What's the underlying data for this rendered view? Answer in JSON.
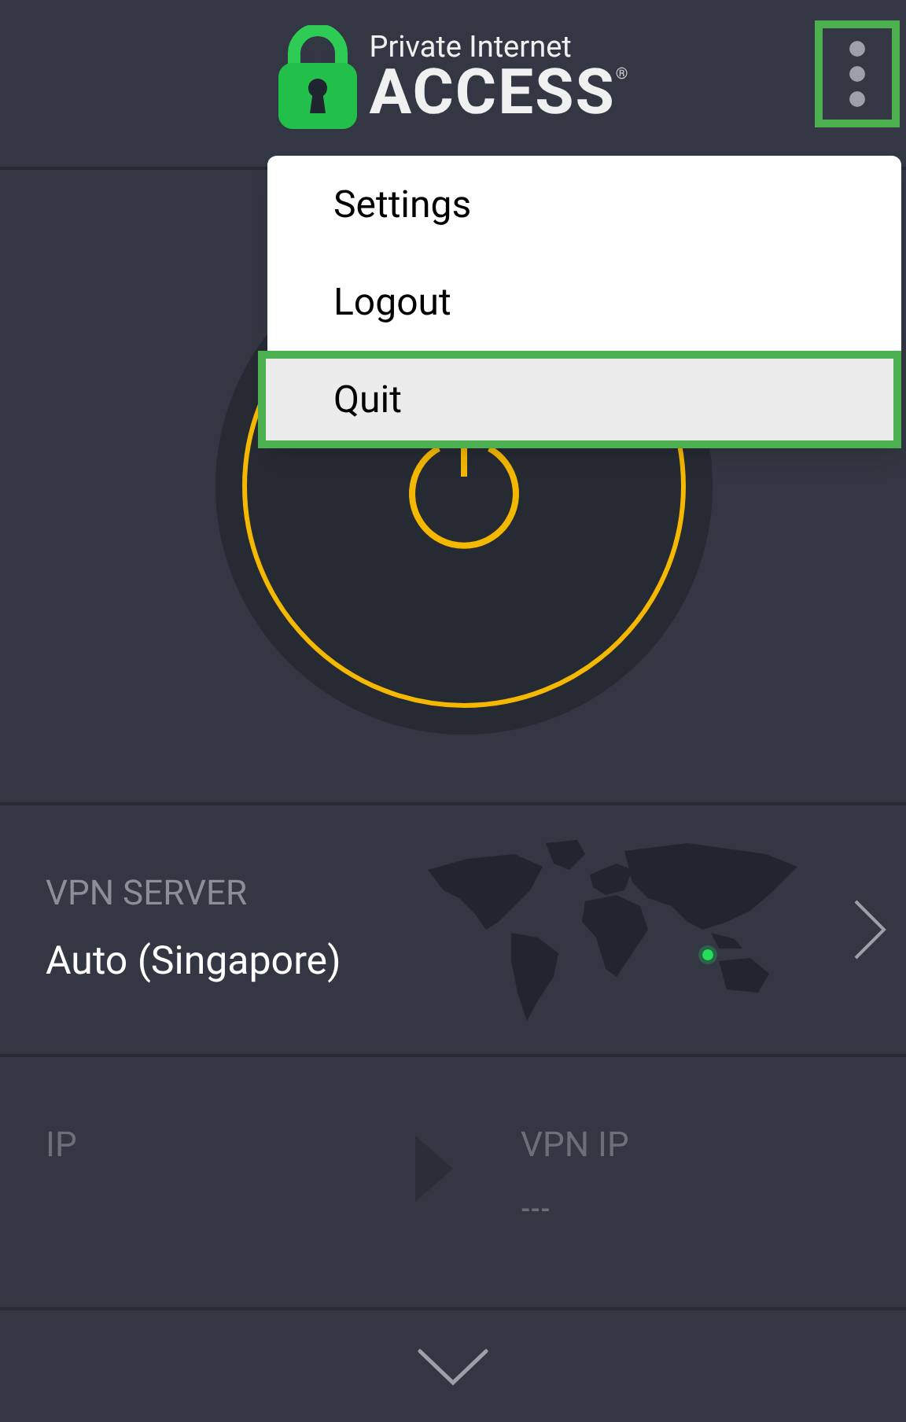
{
  "header": {
    "logo_top": "Private Internet",
    "logo_bottom": "ACCESS",
    "logo_mark": "®",
    "menu_button": {
      "highlighted": true
    }
  },
  "menu": {
    "items": [
      {
        "label": "Settings",
        "selected": false
      },
      {
        "label": "Logout",
        "selected": false
      },
      {
        "label": "Quit",
        "selected": true
      }
    ]
  },
  "server": {
    "label": "VPN SERVER",
    "value": "Auto (Singapore)"
  },
  "ip": {
    "label": "IP"
  },
  "vpn_ip": {
    "label": "VPN IP",
    "value": "---"
  }
}
